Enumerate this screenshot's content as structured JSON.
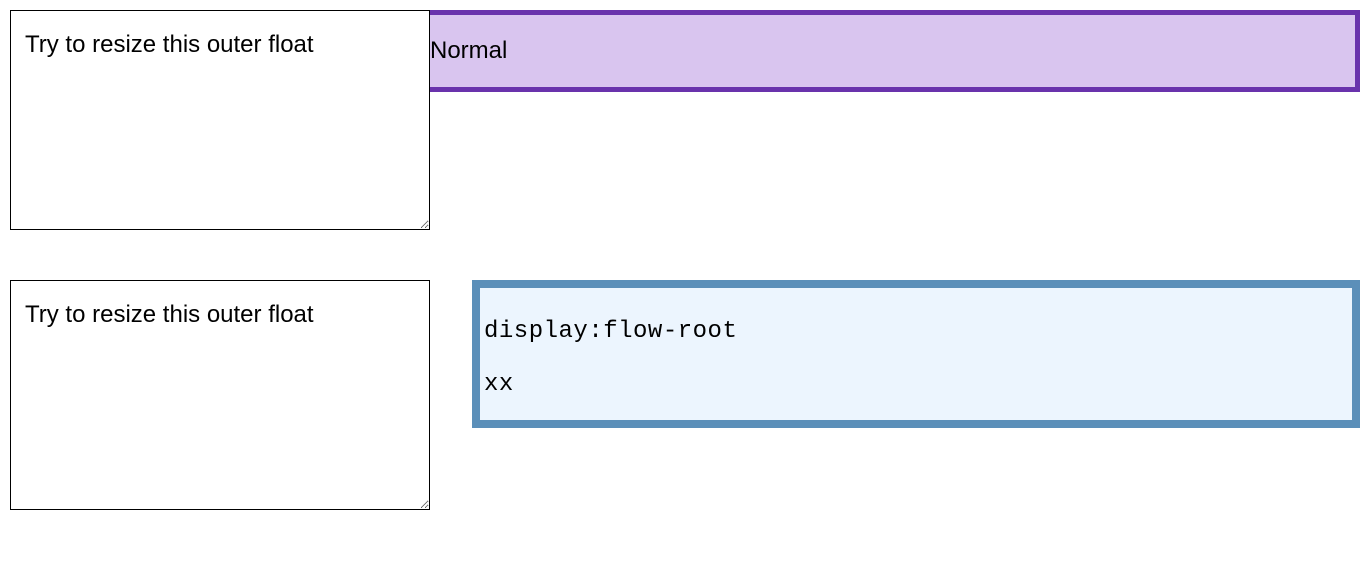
{
  "example1": {
    "float_text": "Try to resize this outer float",
    "box_text": "Normal"
  },
  "example2": {
    "float_text": "Try to resize this outer float",
    "code_line": "display:flow-root",
    "body_line": "xx"
  }
}
